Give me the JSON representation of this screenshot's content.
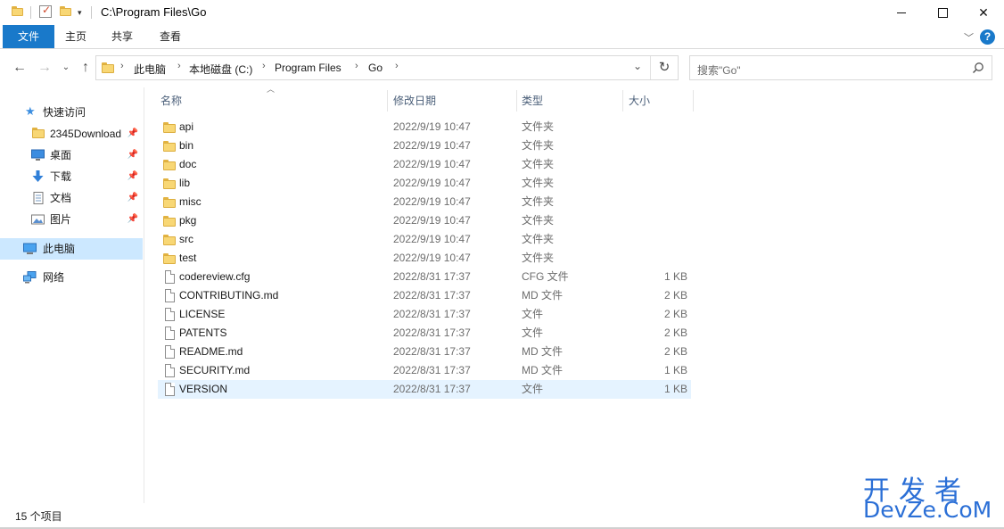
{
  "window": {
    "title": "C:\\Program Files\\Go"
  },
  "ribbon": {
    "tabs": [
      "文件",
      "主页",
      "共享",
      "查看"
    ]
  },
  "breadcrumb": [
    "此电脑",
    "本地磁盘 (C:)",
    "Program Files",
    "Go"
  ],
  "search": {
    "placeholder": "搜索\"Go\""
  },
  "sidebar": {
    "quick_access": "快速访问",
    "pinned": [
      "2345Download",
      "桌面",
      "下载",
      "文档",
      "图片"
    ],
    "this_pc": "此电脑",
    "network": "网络"
  },
  "columns": {
    "name": "名称",
    "date": "修改日期",
    "type": "类型",
    "size": "大小"
  },
  "files": [
    {
      "name": "api",
      "date": "2022/9/19 10:47",
      "type": "文件夹",
      "size": "",
      "kind": "folder"
    },
    {
      "name": "bin",
      "date": "2022/9/19 10:47",
      "type": "文件夹",
      "size": "",
      "kind": "folder"
    },
    {
      "name": "doc",
      "date": "2022/9/19 10:47",
      "type": "文件夹",
      "size": "",
      "kind": "folder"
    },
    {
      "name": "lib",
      "date": "2022/9/19 10:47",
      "type": "文件夹",
      "size": "",
      "kind": "folder"
    },
    {
      "name": "misc",
      "date": "2022/9/19 10:47",
      "type": "文件夹",
      "size": "",
      "kind": "folder"
    },
    {
      "name": "pkg",
      "date": "2022/9/19 10:47",
      "type": "文件夹",
      "size": "",
      "kind": "folder"
    },
    {
      "name": "src",
      "date": "2022/9/19 10:47",
      "type": "文件夹",
      "size": "",
      "kind": "folder"
    },
    {
      "name": "test",
      "date": "2022/9/19 10:47",
      "type": "文件夹",
      "size": "",
      "kind": "folder"
    },
    {
      "name": "codereview.cfg",
      "date": "2022/8/31 17:37",
      "type": "CFG 文件",
      "size": "1 KB",
      "kind": "file"
    },
    {
      "name": "CONTRIBUTING.md",
      "date": "2022/8/31 17:37",
      "type": "MD 文件",
      "size": "2 KB",
      "kind": "file"
    },
    {
      "name": "LICENSE",
      "date": "2022/8/31 17:37",
      "type": "文件",
      "size": "2 KB",
      "kind": "file"
    },
    {
      "name": "PATENTS",
      "date": "2022/8/31 17:37",
      "type": "文件",
      "size": "2 KB",
      "kind": "file"
    },
    {
      "name": "README.md",
      "date": "2022/8/31 17:37",
      "type": "MD 文件",
      "size": "2 KB",
      "kind": "file"
    },
    {
      "name": "SECURITY.md",
      "date": "2022/8/31 17:37",
      "type": "MD 文件",
      "size": "1 KB",
      "kind": "file"
    },
    {
      "name": "VERSION",
      "date": "2022/8/31 17:37",
      "type": "文件",
      "size": "1 KB",
      "kind": "file",
      "selected": true
    }
  ],
  "status": {
    "item_count": "15 个项目"
  },
  "watermark": {
    "line1": "开发者",
    "line2": "DevZe.CoM"
  },
  "colors": {
    "accent": "#1979ca",
    "folder": "#f8d775",
    "selection": "#cce8ff",
    "hover_row": "#e5f3ff",
    "watermark": "#2b6fd6"
  }
}
